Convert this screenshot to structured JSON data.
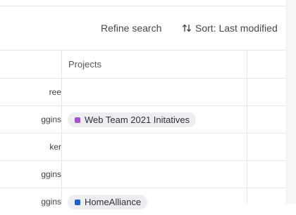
{
  "toolbar": {
    "refine_label": "Refine search",
    "sort_label": "Sort: Last modified",
    "sort_icon": "sort-arrows-icon"
  },
  "table": {
    "column_header": "Projects",
    "rows": [
      {
        "owner": "ree",
        "project": null
      },
      {
        "owner": "ggins",
        "project": {
          "label": "Web Team 2021 Initatives",
          "color": "#a450d8"
        }
      },
      {
        "owner": "ker",
        "project": null
      },
      {
        "owner": "ggins",
        "project": null
      },
      {
        "owner": "ggins",
        "project": {
          "label": "HomeAlliance",
          "color": "#1f5fd1"
        }
      }
    ]
  },
  "colors": {
    "border": "#e6e6ea",
    "chip_bg": "#eceef1"
  }
}
